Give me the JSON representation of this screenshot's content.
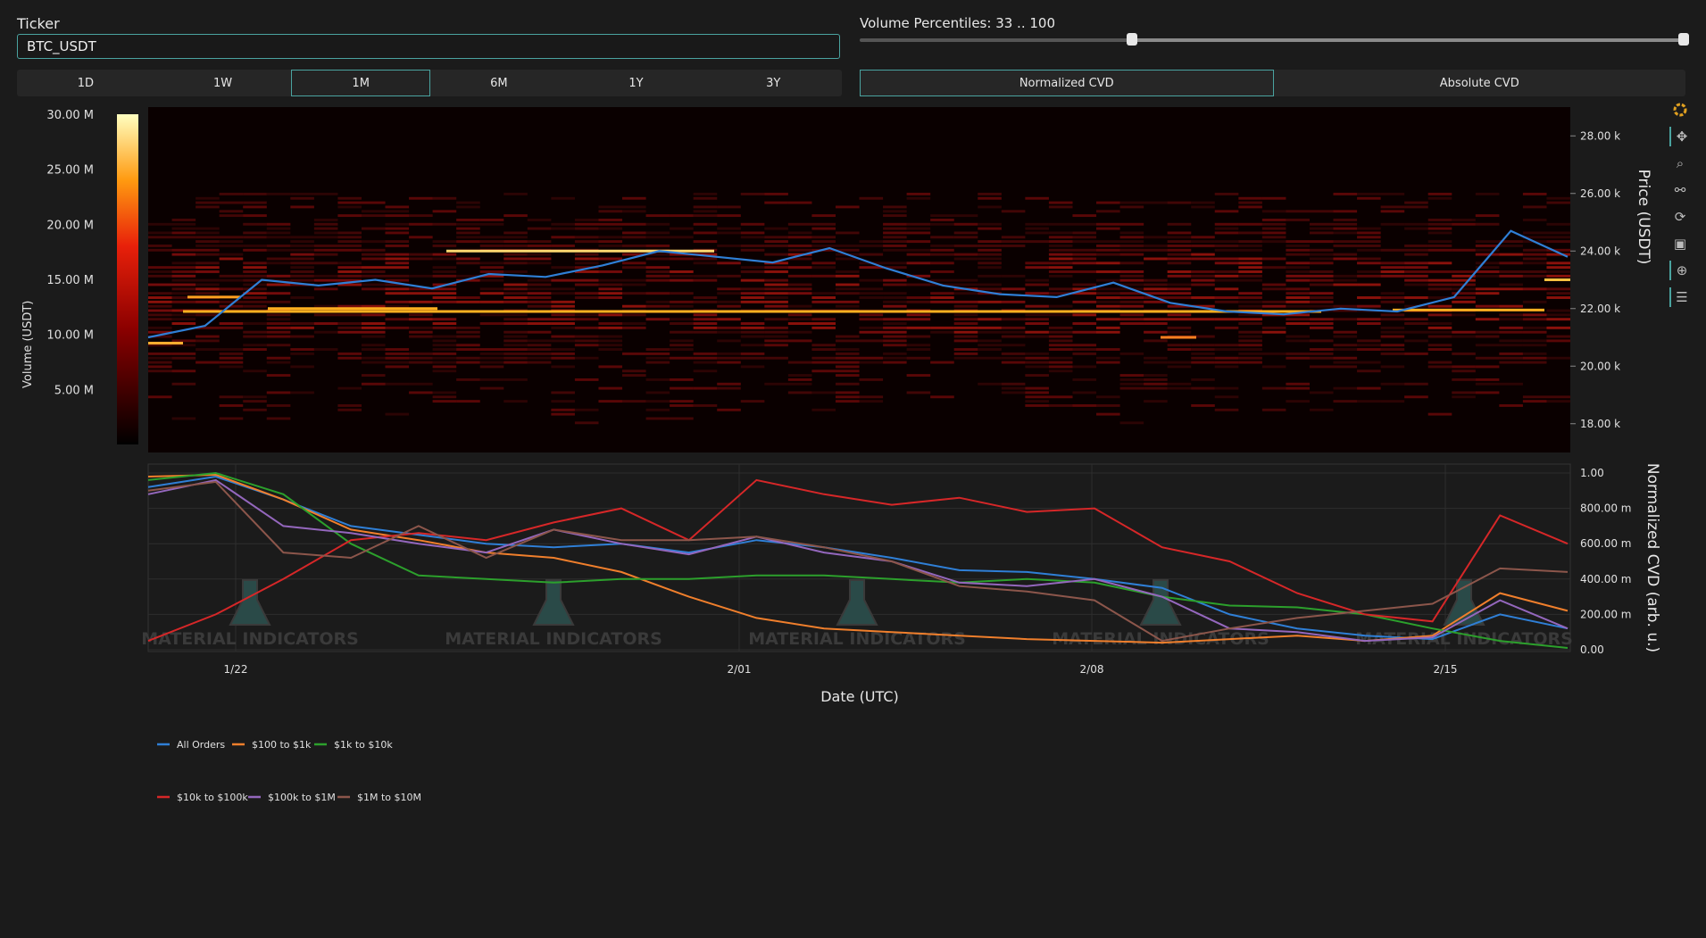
{
  "ticker": {
    "label": "Ticker",
    "value": "BTC_USDT"
  },
  "timeframes": [
    {
      "label": "1D",
      "active": false
    },
    {
      "label": "1W",
      "active": false
    },
    {
      "label": "1M",
      "active": true
    },
    {
      "label": "6M",
      "active": false
    },
    {
      "label": "1Y",
      "active": false
    },
    {
      "label": "3Y",
      "active": false
    }
  ],
  "volume_percentiles": {
    "title": "Volume Percentiles: 33 .. 100",
    "min": 33,
    "max": 100
  },
  "cvd_modes": [
    {
      "label": "Normalized CVD",
      "active": true
    },
    {
      "label": "Absolute CVD",
      "active": false
    }
  ],
  "watermark": "MATERIAL INDICATORS",
  "colors": {
    "accent": "#4aa3a0",
    "background": "#1b1b1b",
    "price_line": "#2f7fd6"
  },
  "toolbar_icons": [
    "plotly-logo-icon",
    "pan-icon",
    "zoom-icon",
    "zoom-out-icon",
    "reset-icon",
    "save-icon",
    "crosshair-icon",
    "comment-icon"
  ],
  "chart_data": [
    {
      "type": "heatmap",
      "xlabel": "",
      "ylabel": "Price (USDT)",
      "ylim": [
        17000,
        29000
      ],
      "y_ticks": [
        "18.00 k",
        "20.00 k",
        "22.00 k",
        "24.00 k",
        "26.00 k",
        "28.00 k"
      ],
      "colorbar": {
        "title": "Volume (USDT)",
        "ticks": [
          "5.00 M",
          "10.00 M",
          "15.00 M",
          "20.00 M",
          "25.00 M",
          "30.00 M"
        ],
        "range": [
          0,
          30000000
        ]
      },
      "series": [
        {
          "name": "price",
          "values": [
            21000,
            21400,
            23000,
            22800,
            23000,
            22700,
            23200,
            23100,
            23500,
            24000,
            23800,
            23600,
            24100,
            23400,
            22800,
            22500,
            22400,
            22900,
            22200,
            21900,
            21800,
            22000,
            21900,
            22400,
            24700,
            23800
          ]
        }
      ]
    },
    {
      "type": "line",
      "xlabel": "Date (UTC)",
      "ylabel": "Normalized CVD (arb. u.)",
      "ylim": [
        0,
        1
      ],
      "y_ticks": [
        "0.00",
        "200.00 m",
        "400.00 m",
        "600.00 m",
        "800.00 m",
        "1.00"
      ],
      "x_ticks": [
        "1/22",
        "2/01",
        "2/08",
        "2/15"
      ],
      "legend": "bottom",
      "series": [
        {
          "name": "All Orders",
          "color": "#2f7fd6",
          "values": [
            0.92,
            0.98,
            0.85,
            0.7,
            0.65,
            0.6,
            0.58,
            0.6,
            0.55,
            0.62,
            0.58,
            0.52,
            0.45,
            0.44,
            0.4,
            0.35,
            0.2,
            0.12,
            0.08,
            0.06,
            0.2,
            0.12
          ]
        },
        {
          "name": "$100 to $1k",
          "color": "#f07f2c",
          "values": [
            0.98,
            0.99,
            0.85,
            0.68,
            0.62,
            0.55,
            0.52,
            0.44,
            0.3,
            0.18,
            0.12,
            0.1,
            0.08,
            0.06,
            0.05,
            0.04,
            0.06,
            0.08,
            0.05,
            0.08,
            0.32,
            0.22
          ]
        },
        {
          "name": "$1k to $10k",
          "color": "#2ca02c",
          "values": [
            0.96,
            1.0,
            0.88,
            0.6,
            0.42,
            0.4,
            0.38,
            0.4,
            0.4,
            0.42,
            0.42,
            0.4,
            0.38,
            0.4,
            0.38,
            0.3,
            0.25,
            0.24,
            0.2,
            0.12,
            0.05,
            0.01
          ]
        },
        {
          "name": "$10k to $100k",
          "color": "#d62728",
          "values": [
            0.05,
            0.2,
            0.4,
            0.62,
            0.66,
            0.62,
            0.72,
            0.8,
            0.62,
            0.96,
            0.88,
            0.82,
            0.86,
            0.78,
            0.8,
            0.58,
            0.5,
            0.32,
            0.2,
            0.16,
            0.76,
            0.6
          ]
        },
        {
          "name": "$100k to $1M",
          "color": "#9467bd",
          "values": [
            0.88,
            0.96,
            0.7,
            0.66,
            0.6,
            0.55,
            0.68,
            0.6,
            0.54,
            0.64,
            0.55,
            0.5,
            0.38,
            0.36,
            0.4,
            0.3,
            0.12,
            0.1,
            0.05,
            0.07,
            0.28,
            0.12
          ]
        },
        {
          "name": "$1M to $10M",
          "color": "#8c564b",
          "values": [
            0.9,
            0.95,
            0.55,
            0.52,
            0.7,
            0.52,
            0.68,
            0.62,
            0.62,
            0.64,
            0.58,
            0.5,
            0.36,
            0.33,
            0.28,
            0.05,
            0.12,
            0.18,
            0.22,
            0.26,
            0.46,
            0.44
          ]
        }
      ]
    }
  ]
}
